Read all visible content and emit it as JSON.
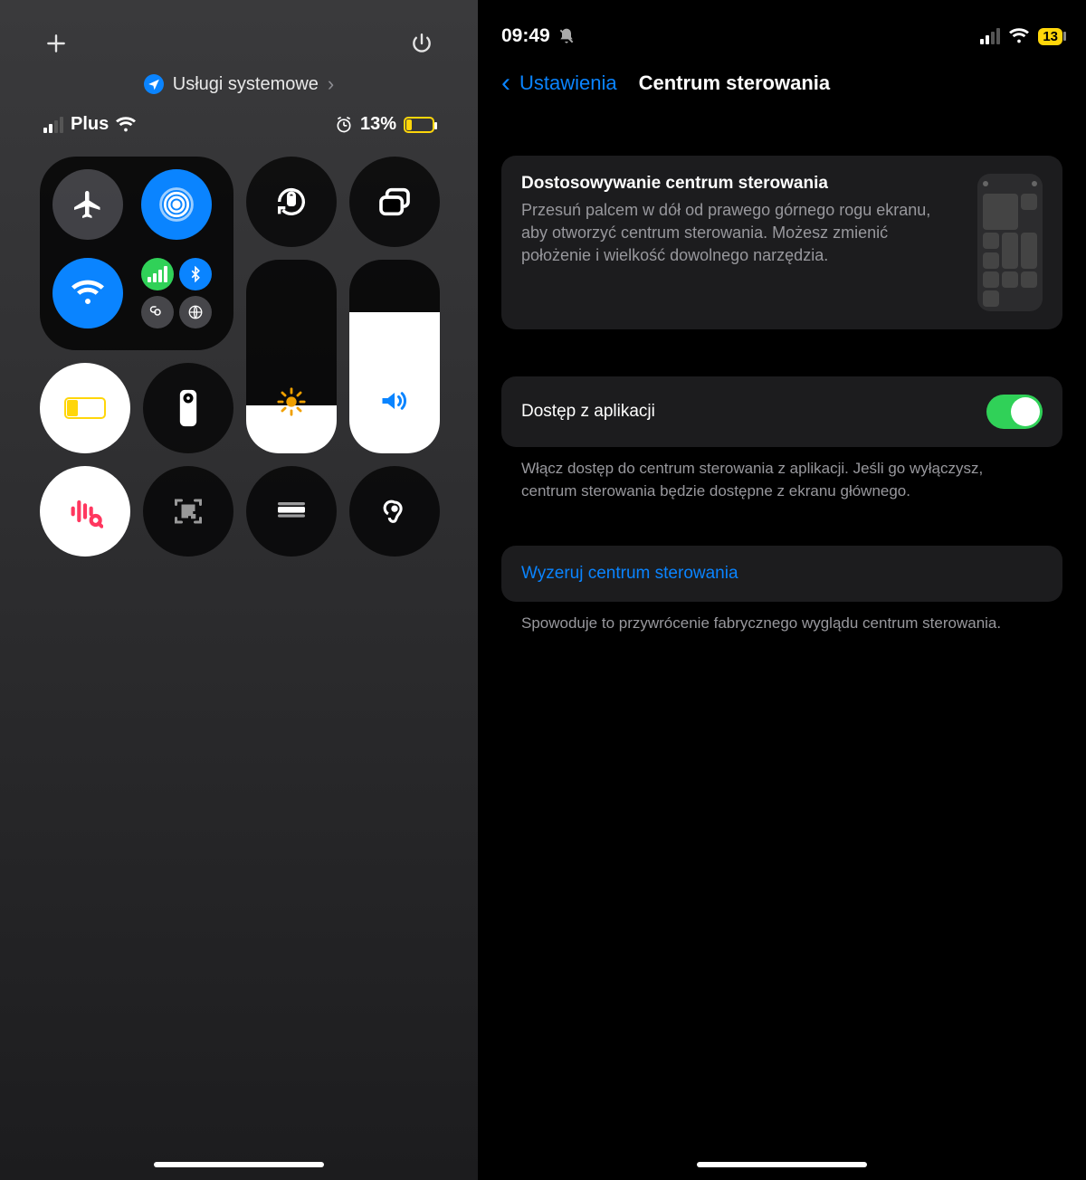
{
  "left": {
    "sys_services_label": "Usługi systemowe",
    "carrier": "Plus",
    "battery_text": "13%",
    "battery_pct": 13,
    "brightness_pct": 25,
    "volume_pct": 73
  },
  "right": {
    "time": "09:49",
    "battery_box": "13",
    "back_label": "Ustawienia",
    "page_title": "Centrum sterowania",
    "card_title": "Dostosowywanie centrum sterowania",
    "card_body": "Przesuń palcem w dół od prawego górnego rogu ekranu, aby otworzyć centrum sterowania. Możesz zmienić położenie i wielkość dowolnego narzędzia.",
    "access_label": "Dostęp z aplikacji",
    "access_footer": "Włącz dostęp do centrum sterowania z aplikacji. Jeśli go wyłączysz, centrum sterowania będzie dostępne z ekranu głównego.",
    "reset_label": "Wyzeruj centrum sterowania",
    "reset_footer": "Spowoduje to przywrócenie fabrycznego wyglądu centrum sterowania."
  }
}
